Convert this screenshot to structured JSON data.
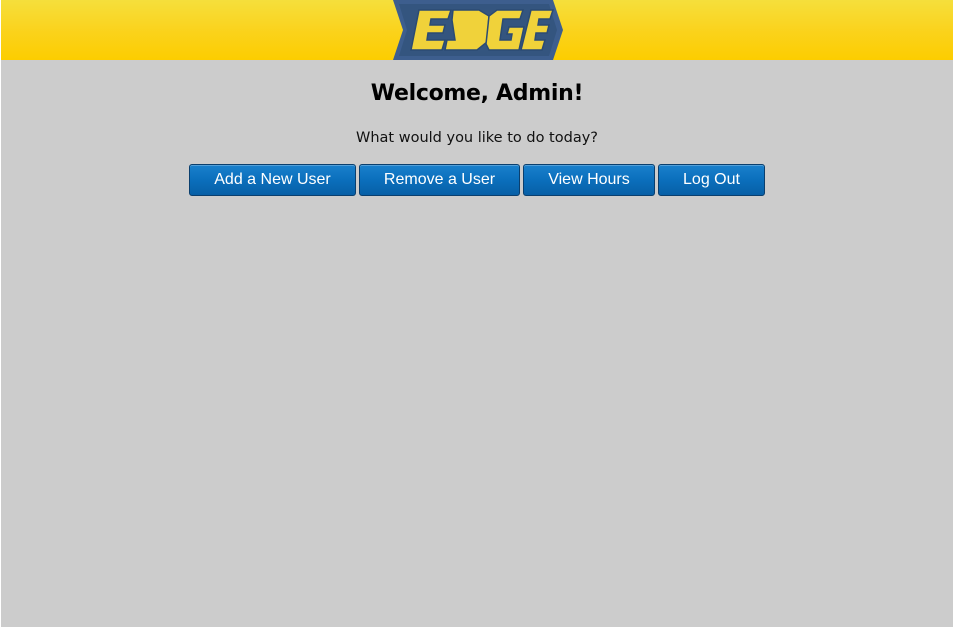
{
  "header": {
    "logo_text": "EDGE",
    "colors": {
      "band": "#fccd00",
      "logo_shape": "#3a5f8f",
      "logo_letters": "#f0d23a"
    }
  },
  "main": {
    "title": "Welcome, Admin!",
    "subtitle": "What would you like to do today?"
  },
  "actions": {
    "add_user": "Add a New User",
    "remove_user": "Remove a User",
    "view_hours": "View Hours",
    "log_out": "Log Out"
  },
  "colors": {
    "page_background": "#cccccc",
    "button": "#0b6fbc",
    "button_text": "#ffffff"
  }
}
